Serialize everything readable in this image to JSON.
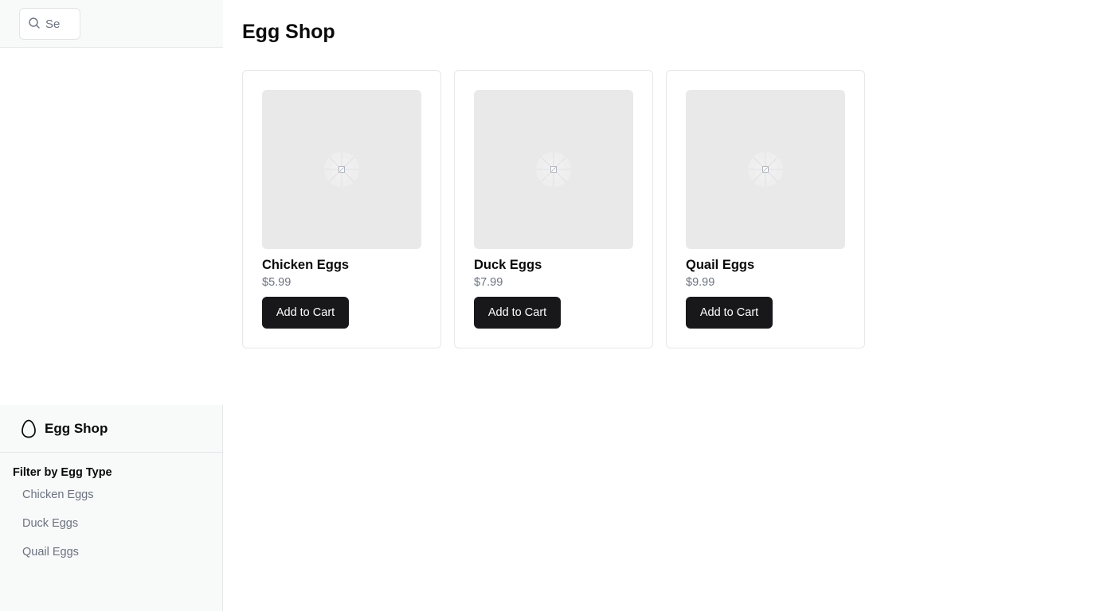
{
  "search": {
    "placeholder": "Se"
  },
  "brand": {
    "title": "Egg Shop",
    "icon": "egg-icon"
  },
  "filters": {
    "heading": "Filter by Egg Type",
    "items": [
      {
        "label": "Chicken Eggs"
      },
      {
        "label": "Duck Eggs"
      },
      {
        "label": "Quail Eggs"
      }
    ]
  },
  "main": {
    "title": "Egg Shop",
    "products": [
      {
        "name": "Chicken Eggs",
        "price": "$5.99",
        "button": "Add to Cart"
      },
      {
        "name": "Duck Eggs",
        "price": "$7.99",
        "button": "Add to Cart"
      },
      {
        "name": "Quail Eggs",
        "price": "$9.99",
        "button": "Add to Cart"
      }
    ]
  },
  "colors": {
    "sidebar_bg": "#f8f9f9",
    "button_bg": "#18181b",
    "muted_text": "#6b7280",
    "placeholder_bg": "#e9e9e9"
  }
}
